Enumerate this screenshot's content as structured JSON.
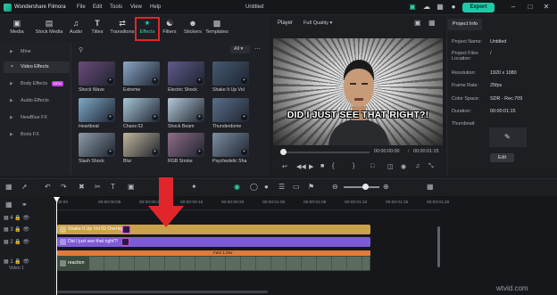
{
  "app": {
    "name": "Wondershare Filmora",
    "document_title": "Untitled",
    "menu": [
      "File",
      "Edit",
      "Tools",
      "View",
      "Help"
    ],
    "export_label": "Export",
    "title_icons": [
      "gift-icon",
      "cloud-icon",
      "grid-icon",
      "minimize-icon",
      "maximize-icon",
      "close-icon"
    ]
  },
  "media_tabs": [
    {
      "label": "Media",
      "icon": "media-icon"
    },
    {
      "label": "Stock Media",
      "icon": "stock-media-icon"
    },
    {
      "label": "Audio",
      "icon": "audio-icon"
    },
    {
      "label": "Titles",
      "icon": "titles-icon"
    },
    {
      "label": "Transitions",
      "icon": "transitions-icon"
    },
    {
      "label": "Effects",
      "icon": "effects-icon",
      "active": true
    },
    {
      "label": "Filters",
      "icon": "filters-icon"
    },
    {
      "label": "Stickers",
      "icon": "stickers-icon"
    },
    {
      "label": "Templates",
      "icon": "templates-icon"
    }
  ],
  "categories": [
    {
      "label": "Mine",
      "selected": false
    },
    {
      "label": "Video Effects",
      "selected": true
    },
    {
      "label": "Body Effects",
      "badge": "NEW"
    },
    {
      "label": "Audio Effects"
    },
    {
      "label": "NewBlue FX"
    },
    {
      "label": "Boris FX"
    }
  ],
  "grid": {
    "filter_value": "All",
    "effects": [
      {
        "label": "Shock Wave",
        "color": "#6b4b7a"
      },
      {
        "label": "Extreme",
        "color": "#8aa7c6"
      },
      {
        "label": "Electric Shock",
        "color": "#5e5a8a"
      },
      {
        "label": "Shake It Up Vol",
        "color": "#445a72"
      },
      {
        "label": "Heartbeat",
        "color": "#7fa9c9"
      },
      {
        "label": "Chaos 02",
        "color": "#a7c6d8"
      },
      {
        "label": "Shock Beam",
        "color": "#b5c9d8"
      },
      {
        "label": "Thunderdome",
        "color": "#5a6f8a"
      },
      {
        "label": "Slash Shock",
        "color": "#8c9ba8"
      },
      {
        "label": "Blur",
        "color": "#c2b59a"
      },
      {
        "label": "RGB Stroke",
        "color": "#8f6d86"
      },
      {
        "label": "Psychedelic Sha",
        "color": "#7c8fa3"
      }
    ]
  },
  "player": {
    "label": "Player",
    "quality": "Full Quality",
    "caption": "DID I JUST SEE THAT RIGHT?!",
    "current_time": "00:00:00:00",
    "total_time": "00:00:01:15"
  },
  "project_info": {
    "tab": "Project Info",
    "rows": [
      {
        "key": "Project Name:",
        "value": "Untitled"
      },
      {
        "key": "Project Files Location:",
        "value": "/"
      },
      {
        "key": "Resolution:",
        "value": "1920 x 1080"
      },
      {
        "key": "Frame Rate:",
        "value": "25fps"
      },
      {
        "key": "Color Space:",
        "value": "SDR - Rec.709"
      },
      {
        "key": "Duration:",
        "value": "00:00:01:15"
      },
      {
        "key": "Thumbnail:",
        "value": ""
      }
    ],
    "edit_label": "Edit"
  },
  "timeline": {
    "ruler": [
      "00:00",
      "00:00:00:05",
      "00:00:00:10",
      "00:00:00:15",
      "00:00:00:20",
      "00:00:01:00",
      "00:00:01:05",
      "00:00:01:10",
      "00:00:01:15",
      "00:00:01:20"
    ],
    "tracks": [
      {
        "index": "4"
      },
      {
        "index": "3"
      },
      {
        "index": "2"
      },
      {
        "index": "1"
      }
    ],
    "track_footer": "Video 1",
    "clips": [
      {
        "label": "Shake It Up Vol 02 Overlay 0",
        "color": "#c9a24a"
      },
      {
        "label": "Did I just see that right?!",
        "color": "#7e5bd6"
      },
      {
        "label": "Fast 1.00x",
        "color": "#e07b3c"
      },
      {
        "label": "reaction",
        "color": "#3b4a3f"
      }
    ]
  },
  "watermark": "wtvid.com"
}
